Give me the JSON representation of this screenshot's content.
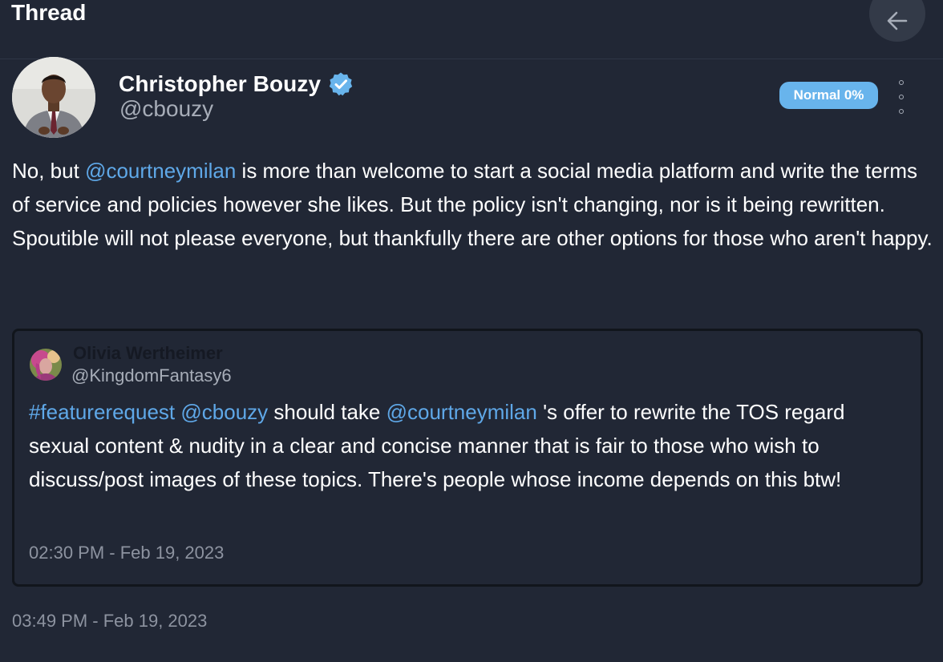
{
  "header": {
    "title": "Thread",
    "back_icon": "arrow-left-icon"
  },
  "post": {
    "author_name": "Christopher Bouzy",
    "verified_icon": "verified-badge-icon",
    "handle": "@cbouzy",
    "badge": "Normal 0%",
    "more_icon": "kebab-menu-icon",
    "body": [
      {
        "type": "text",
        "value": "No, but "
      },
      {
        "type": "mention",
        "value": "@courtneymilan"
      },
      {
        "type": "text",
        "value": " is more than welcome to start a social media platform and write the terms of service and policies however she likes. But the policy isn't changing, nor is it being rewritten. Spoutible will not please everyone, but thankfully there are other options for those who aren't happy."
      }
    ],
    "timestamp": "03:49 PM - Feb 19, 2023"
  },
  "quote": {
    "author_name": "Olivia Wertheimer",
    "handle": "@KingdomFantasy6",
    "body": [
      {
        "type": "mention",
        "value": "#featurerequest"
      },
      {
        "type": "text",
        "value": " "
      },
      {
        "type": "mention",
        "value": "@cbouzy"
      },
      {
        "type": "text",
        "value": " should take "
      },
      {
        "type": "mention",
        "value": "@courtneymilan"
      },
      {
        "type": "text",
        "value": " 's offer to rewrite the TOS regard sexual content & nudity in a clear and concise manner that is fair to those who wish to discuss/post images of these topics. There's people whose income depends on this btw!"
      }
    ],
    "timestamp": "02:30 PM - Feb 19, 2023"
  },
  "colors": {
    "background": "#212735",
    "accent": "#5fa8e8",
    "badge": "#68b4ec",
    "muted": "#a7adb8"
  }
}
